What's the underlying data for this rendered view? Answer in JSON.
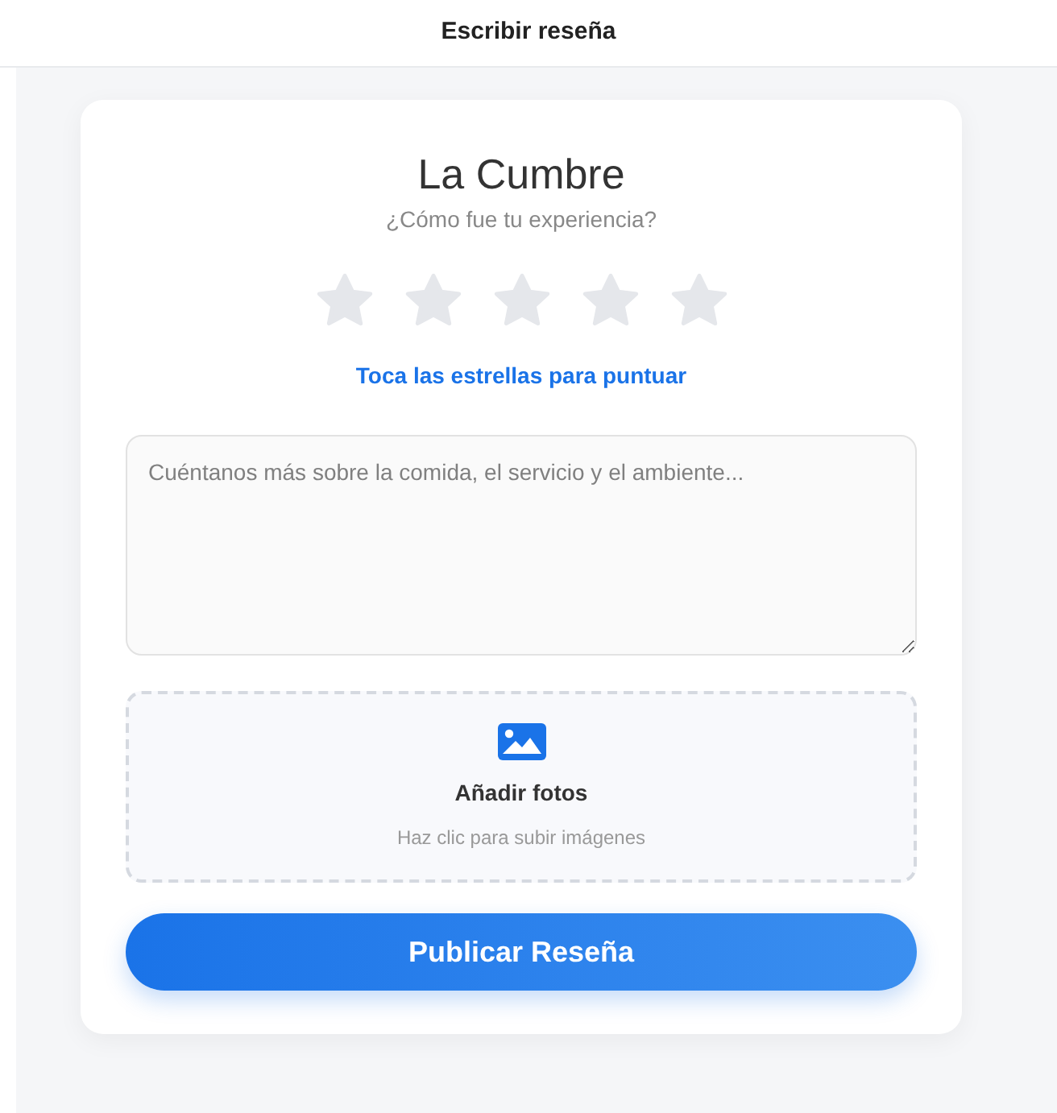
{
  "header": {
    "title": "Escribir reseña"
  },
  "restaurant": {
    "name": "La Cumbre",
    "question": "¿Cómo fue tu experiencia?"
  },
  "rating": {
    "stars": 0,
    "hint": "Toca las estrellas para puntuar"
  },
  "review_field": {
    "placeholder": "Cuéntanos más sobre la comida, el servicio y el ambiente..."
  },
  "photo_upload": {
    "title": "Añadir fotos",
    "subtitle": "Haz clic para subir imágenes"
  },
  "submit_button": {
    "label": "Publicar Reseña"
  }
}
